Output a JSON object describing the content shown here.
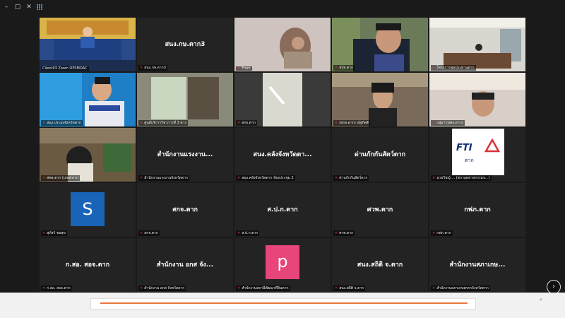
{
  "window": {
    "minimize": "–",
    "restore": "▢",
    "close": "✕"
  },
  "tiles": [
    {
      "name": "Client03 Zoom OPSMOAC",
      "label": "",
      "video": "ceremony"
    },
    {
      "name": "สนง.กษ.ตาก3",
      "label": "สนง.กษ.ตาก3",
      "video": ""
    },
    {
      "name": "From",
      "label": "",
      "video": "hand"
    },
    {
      "name": "สปจ.ตาก",
      "label": "",
      "video": "man"
    },
    {
      "name": "โครงการชลประทานตาก",
      "label": "",
      "video": "room"
    },
    {
      "name": "สนง.ประมงจังหวัดตาก",
      "label": "",
      "video": "woman-blue"
    },
    {
      "name": "ศูนย์บริการวิชาการที่ 3 ตาก",
      "label": "",
      "video": "office"
    },
    {
      "name": "สกจ.ตาก",
      "label": "",
      "video": "light"
    },
    {
      "name": "(สกจ.ตาก) ณัฐกิตติ",
      "label": "",
      "video": "woman-office"
    },
    {
      "name": "กลุ่มฯ (สศจ.ตาก)",
      "label": "",
      "video": "woman-room"
    },
    {
      "name": "ศพจ.ตาก (เกษตรกร)",
      "label": "",
      "video": "woman-farm"
    },
    {
      "name": "สำนักงานแรงงานจังหวัดตาก",
      "label": "สำนักงานแรงงาน...",
      "video": ""
    },
    {
      "name": "สนง.คลังจังหวัดตาก ห้องประชุม 2",
      "label": "สนง.คลังจังหวัดตา...",
      "video": ""
    },
    {
      "name": "ด่านกักกันสัตว์ตาก",
      "label": "ด่านกักกันสัตว์ตาก",
      "video": ""
    },
    {
      "name": "นายวิชญ์ ... (สภาอุตสาหกรรมจ...)",
      "label": "",
      "video": "fti"
    },
    {
      "name": "สุภัสร์ ขอสุข",
      "label": "",
      "video": "avatar-s"
    },
    {
      "name": "สกจ.ตาก",
      "label": "สกจ.ตาก",
      "video": ""
    },
    {
      "name": "ส.ป.ก.ตาก",
      "label": "ส.ป.ก.ตาก",
      "video": ""
    },
    {
      "name": "ศวพ.ตาก",
      "label": "ศวพ.ตาก",
      "video": ""
    },
    {
      "name": "กฟภ.ตาก",
      "label": "กฟภ.ตาก",
      "video": ""
    },
    {
      "name": "ก.สอ. สอจ.ตาก",
      "label": "ก.สอ. สอจ.ตาก",
      "video": ""
    },
    {
      "name": "สำนักงาน อกส จังหวัดตาก",
      "label": "สำนักงาน อกส จัง...",
      "video": ""
    },
    {
      "name": "สำนักงานสถานีพัฒนาที่ดินตาก",
      "label": "",
      "video": "avatar-p"
    },
    {
      "name": "สนง.สถิติ จ.ตาก",
      "label": "สนง.สถิติ จ.ตาก",
      "video": ""
    },
    {
      "name": "สำนักงานสภาเกษตรกรจังหวัดตาก",
      "label": "สำนักงานสภาเกษ...",
      "video": ""
    }
  ],
  "fti": {
    "brand": "FTI",
    "sub": "ตาก"
  },
  "avatars": {
    "s": "S",
    "p": "p"
  },
  "controls": {
    "next_page": "›"
  },
  "colors": {
    "active_border": "#c9e05a",
    "mic_muted": "#e0413a",
    "accent_orange": "#e8773c"
  }
}
